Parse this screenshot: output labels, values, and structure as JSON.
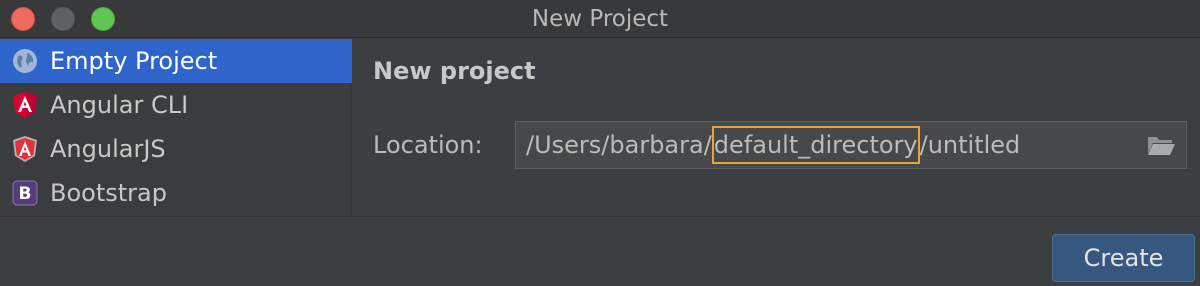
{
  "window": {
    "title": "New Project"
  },
  "sidebar": {
    "items": [
      {
        "label": "Empty Project",
        "icon": "globe-icon",
        "selected": true
      },
      {
        "label": "Angular CLI",
        "icon": "angular-icon",
        "selected": false
      },
      {
        "label": "AngularJS",
        "icon": "angularjs-icon",
        "selected": false
      },
      {
        "label": "Bootstrap",
        "icon": "bootstrap-icon",
        "selected": false
      }
    ]
  },
  "main": {
    "title": "New project",
    "location_label": "Location:",
    "location": {
      "prefix": "/Users/barbara/",
      "highlighted": "default_directory",
      "suffix": "/untitled"
    }
  },
  "footer": {
    "create_label": "Create"
  },
  "colors": {
    "selection": "#2f65ca",
    "highlight_border": "#e8a33d",
    "button": "#365880"
  }
}
